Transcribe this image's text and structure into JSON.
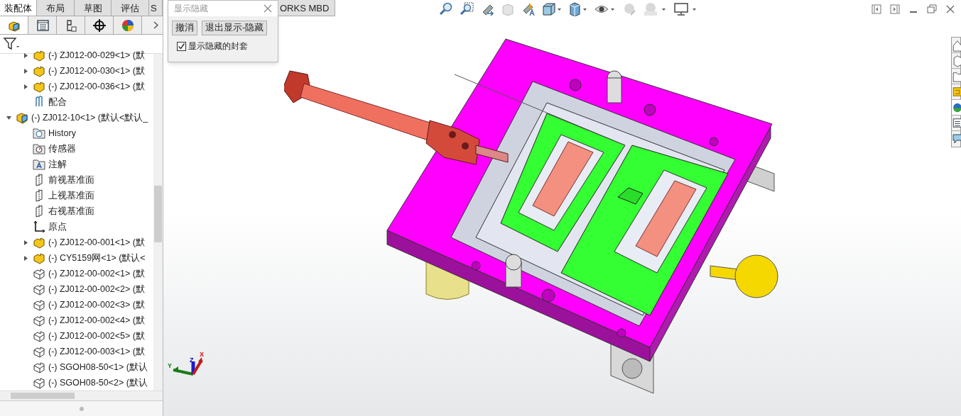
{
  "tabs": [
    {
      "label": "装配体",
      "selected": true
    },
    {
      "label": "布局",
      "selected": false
    },
    {
      "label": "草图",
      "selected": false
    },
    {
      "label": "评估",
      "selected": false
    },
    {
      "label": "S",
      "selected": false
    },
    {
      "label": "ORKS MBD",
      "selected": false
    }
  ],
  "panel_tabs": [
    {
      "kind": "feature-tree",
      "selected": true
    },
    {
      "kind": "property",
      "selected": false
    },
    {
      "kind": "config",
      "selected": false
    },
    {
      "kind": "dimxpert",
      "selected": false
    },
    {
      "kind": "display",
      "selected": false
    }
  ],
  "tree": {
    "continued": [
      {
        "kind": "part",
        "label": "(-) ZJ012-00-029<1> (默",
        "expanded": false
      },
      {
        "kind": "part",
        "label": "(-) ZJ012-00-030<1> (默",
        "expanded": false
      },
      {
        "kind": "part",
        "label": "(-) ZJ012-00-036<1> (默",
        "expanded": false
      },
      {
        "kind": "mates",
        "label": "配合"
      }
    ],
    "items": [
      {
        "kind": "assembly",
        "label": "(-) ZJ012-10<1> (默认<默认_",
        "expanded": true,
        "children": [
          {
            "kind": "history",
            "label": "History"
          },
          {
            "kind": "sensors",
            "label": "传感器"
          },
          {
            "kind": "annotations",
            "label": "注解"
          },
          {
            "kind": "plane",
            "label": "前视基准面"
          },
          {
            "kind": "plane",
            "label": "上视基准面"
          },
          {
            "kind": "plane",
            "label": "右视基准面"
          },
          {
            "kind": "origin",
            "label": "原点"
          },
          {
            "kind": "part",
            "label": "(-) ZJ012-00-001<1> (默",
            "expanded": false
          },
          {
            "kind": "part",
            "label": "(-) CY5159网<1> (默认<",
            "expanded": false
          },
          {
            "kind": "hidden-part",
            "label": "(-) ZJ012-00-002<1> (默"
          },
          {
            "kind": "hidden-part",
            "label": "(-) ZJ012-00-002<2> (默"
          },
          {
            "kind": "hidden-part",
            "label": "(-) ZJ012-00-002<3> (默"
          },
          {
            "kind": "hidden-part",
            "label": "(-) ZJ012-00-002<4> (默"
          },
          {
            "kind": "hidden-part",
            "label": "(-) ZJ012-00-002<5> (默"
          },
          {
            "kind": "hidden-part",
            "label": "(-) ZJ012-00-003<1> (默"
          },
          {
            "kind": "hidden-part",
            "label": "(-) SGOH08-50<1> (默认"
          },
          {
            "kind": "hidden-part",
            "label": "(-) SGOH08-50<2> (默认"
          }
        ]
      }
    ]
  },
  "popup": {
    "title": "显示隐藏",
    "buttons": [
      "撤消",
      "退出显示-隐藏"
    ],
    "checkbox": {
      "label": "显示隐藏的封套",
      "checked": true
    }
  },
  "triad": {
    "x": "X",
    "y": "Y",
    "z": "Z"
  }
}
